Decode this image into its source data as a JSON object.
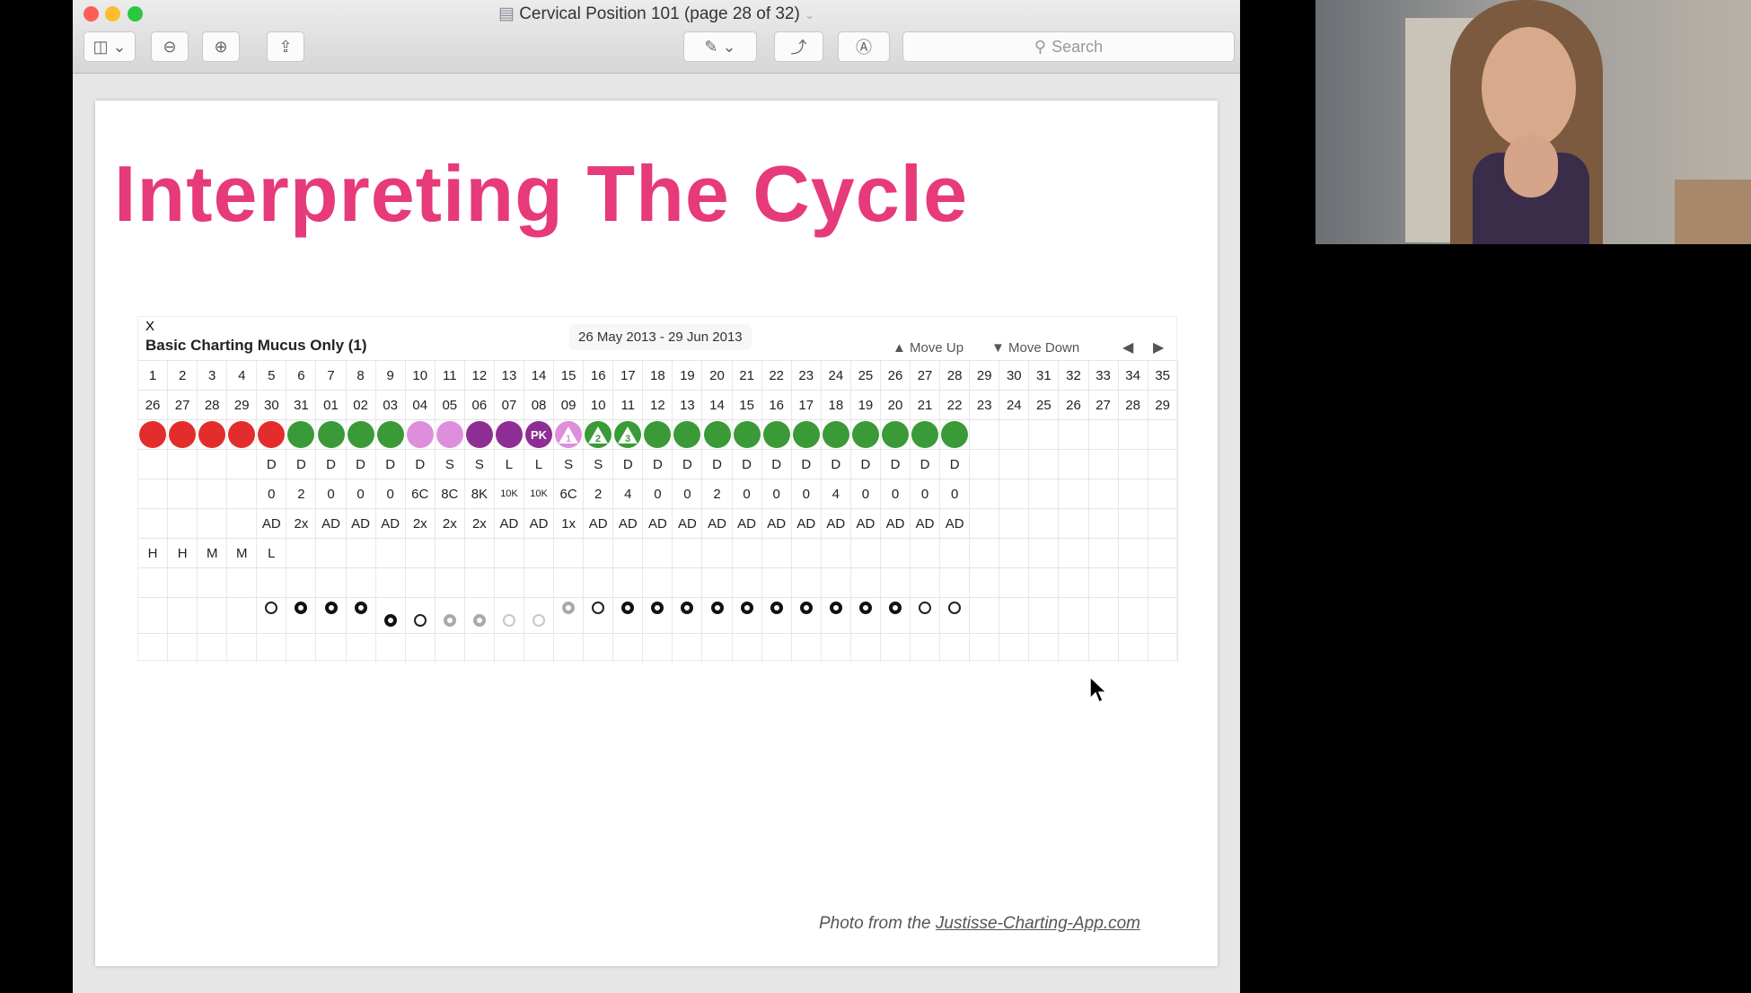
{
  "window": {
    "title": "Cervical Position 101 (page 28 of 32)",
    "search_placeholder": "Search"
  },
  "slide": {
    "heading": "Interpreting The Cycle",
    "credit_prefix": "Photo from the ",
    "credit_link": "Justisse-Charting-App.com"
  },
  "chart": {
    "close": "X",
    "title": "Basic Charting Mucus Only (1)",
    "range": "26 May 2013 - 29 Jun 2013",
    "move_up": "▲ Move Up",
    "move_down": "▼ Move Down",
    "prev": "◀",
    "next": "▶",
    "colors": {
      "red": "#e32d2d",
      "green": "#3a9a37",
      "pink": "#dd8fdc",
      "purple": "#8e2e94"
    },
    "days": [
      "1",
      "2",
      "3",
      "4",
      "5",
      "6",
      "7",
      "8",
      "9",
      "10",
      "11",
      "12",
      "13",
      "14",
      "15",
      "16",
      "17",
      "18",
      "19",
      "20",
      "21",
      "22",
      "23",
      "24",
      "25",
      "26",
      "27",
      "28",
      "29",
      "30",
      "31",
      "32",
      "33",
      "34",
      "35"
    ],
    "dates": [
      "26",
      "27",
      "28",
      "29",
      "30",
      "31",
      "01",
      "02",
      "03",
      "04",
      "05",
      "06",
      "07",
      "08",
      "09",
      "10",
      "11",
      "12",
      "13",
      "14",
      "15",
      "16",
      "17",
      "18",
      "19",
      "20",
      "21",
      "22",
      "23",
      "24",
      "25",
      "26",
      "27",
      "28",
      "29"
    ],
    "stickers": [
      {
        "c": "red"
      },
      {
        "c": "red"
      },
      {
        "c": "red"
      },
      {
        "c": "red"
      },
      {
        "c": "red"
      },
      {
        "c": "green"
      },
      {
        "c": "green"
      },
      {
        "c": "green"
      },
      {
        "c": "green"
      },
      {
        "c": "pink"
      },
      {
        "c": "pink"
      },
      {
        "c": "purple"
      },
      {
        "c": "purple"
      },
      {
        "c": "purple",
        "t": "PK"
      },
      {
        "c": "pink",
        "tri": "1"
      },
      {
        "c": "green",
        "tri": "2"
      },
      {
        "c": "green",
        "tri": "3"
      },
      {
        "c": "green"
      },
      {
        "c": "green"
      },
      {
        "c": "green"
      },
      {
        "c": "green"
      },
      {
        "c": "green"
      },
      {
        "c": "green"
      },
      {
        "c": "green"
      },
      {
        "c": "green"
      },
      {
        "c": "green"
      },
      {
        "c": "green"
      },
      {
        "c": "green"
      }
    ],
    "sensation": [
      "",
      "",
      "",
      "",
      "D",
      "D",
      "D",
      "D",
      "D",
      "D",
      "S",
      "S",
      "L",
      "L",
      "S",
      "S",
      "D",
      "D",
      "D",
      "D",
      "D",
      "D",
      "D",
      "D",
      "D",
      "D",
      "D",
      "D"
    ],
    "mucus": [
      "",
      "",
      "",
      "",
      "0",
      "2",
      "0",
      "0",
      "0",
      "6C",
      "8C",
      "8K",
      "10K",
      "10K",
      "6C",
      "2",
      "4",
      "0",
      "0",
      "2",
      "0",
      "0",
      "0",
      "4",
      "0",
      "0",
      "0",
      "0"
    ],
    "frequency": [
      "",
      "",
      "",
      "",
      "AD",
      "2x",
      "AD",
      "AD",
      "AD",
      "2x",
      "2x",
      "2x",
      "AD",
      "AD",
      "1x",
      "AD",
      "AD",
      "AD",
      "AD",
      "AD",
      "AD",
      "AD",
      "AD",
      "AD",
      "AD",
      "AD",
      "AD",
      "AD"
    ],
    "flow": [
      "H",
      "H",
      "M",
      "M",
      "L"
    ],
    "cervix": [
      null,
      null,
      null,
      null,
      {
        "m": "ring",
        "p": "high"
      },
      {
        "m": "dot",
        "p": "high"
      },
      {
        "m": "dot",
        "p": "high"
      },
      {
        "m": "dot",
        "p": "high"
      },
      {
        "m": "dot",
        "p": "low"
      },
      {
        "m": "ring",
        "p": "low"
      },
      {
        "m": "gray-dot",
        "p": "low"
      },
      {
        "m": "gray-dot",
        "p": "low"
      },
      {
        "m": "light-ring",
        "p": "low"
      },
      {
        "m": "light-ring",
        "p": "low"
      },
      {
        "m": "gray-dot",
        "p": "high"
      },
      {
        "m": "ring",
        "p": "high"
      },
      {
        "m": "dot",
        "p": "high"
      },
      {
        "m": "dot",
        "p": "high"
      },
      {
        "m": "dot",
        "p": "high"
      },
      {
        "m": "dot",
        "p": "high"
      },
      {
        "m": "dot",
        "p": "high"
      },
      {
        "m": "dot",
        "p": "high"
      },
      {
        "m": "dot",
        "p": "high"
      },
      {
        "m": "dot",
        "p": "high"
      },
      {
        "m": "dot",
        "p": "high"
      },
      {
        "m": "dot",
        "p": "high"
      },
      {
        "m": "ring",
        "p": "high"
      },
      {
        "m": "ring",
        "p": "high"
      }
    ]
  }
}
